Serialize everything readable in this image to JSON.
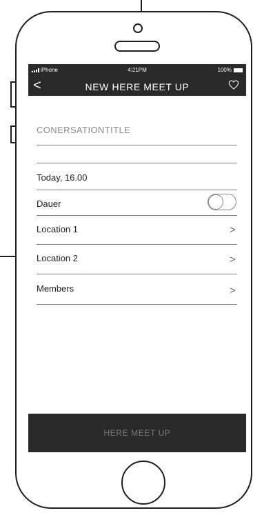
{
  "status_bar": {
    "carrier": "iPhone",
    "time": "4:21PM",
    "battery": "100%"
  },
  "navbar": {
    "back_icon": "chevron-left",
    "back_glyph": "<",
    "title": "NEW HERE MEET UP",
    "favorite_icon": "heart-outline"
  },
  "form": {
    "title_placeholder": "CONERSATIONTITLE",
    "rows": [
      {
        "label": "Today, 16.00"
      },
      {
        "label": "Dauer",
        "control": "toggle",
        "toggle_on": false
      },
      {
        "label": "Location 1",
        "control": "chevron",
        "chevron_glyph": ">"
      },
      {
        "label": "Location 2",
        "control": "chevron",
        "chevron_glyph": ">"
      },
      {
        "label": "Members",
        "control": "chevron",
        "chevron_glyph": ">"
      }
    ]
  },
  "primary_action": {
    "label": "HERE MEET UP"
  },
  "colors": {
    "bar": "#2a2a2a",
    "divider": "#7a7a7a",
    "placeholder": "#8a8a8a"
  }
}
